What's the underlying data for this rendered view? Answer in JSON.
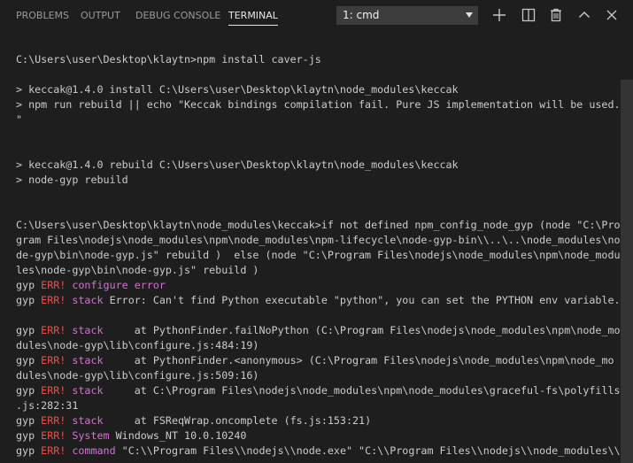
{
  "panel": {
    "tabs": [
      {
        "label": "PROBLEMS"
      },
      {
        "label": "OUTPUT"
      },
      {
        "label": "DEBUG CONSOLE"
      },
      {
        "label": "TERMINAL"
      }
    ],
    "active_tab": "TERMINAL",
    "terminal_select": {
      "value": "1: cmd"
    },
    "actions": [
      "plus-icon",
      "split-terminal-icon",
      "trash-icon",
      "chevron-up-icon",
      "close-icon"
    ]
  },
  "colors": {
    "background": "#1e1e1e",
    "text": "#cccccc",
    "error_red": "#f14c4c",
    "magenta": "#d670d6"
  },
  "terminal": {
    "lines": [
      [
        {
          "t": "C:\\Users\\user\\Desktop\\klaytn>npm install caver-js"
        }
      ],
      [
        {
          "t": ""
        }
      ],
      [
        {
          "t": "> keccak@1.4.0 install C:\\Users\\user\\Desktop\\klaytn\\node_modules\\keccak"
        }
      ],
      [
        {
          "t": "> npm run rebuild || echo \"Keccak bindings compilation fail. Pure JS implementation will be used."
        }
      ],
      [
        {
          "t": "\""
        }
      ],
      [
        {
          "t": ""
        }
      ],
      [
        {
          "t": ""
        }
      ],
      [
        {
          "t": "> keccak@1.4.0 rebuild C:\\Users\\user\\Desktop\\klaytn\\node_modules\\keccak"
        }
      ],
      [
        {
          "t": "> node-gyp rebuild"
        }
      ],
      [
        {
          "t": ""
        }
      ],
      [
        {
          "t": ""
        }
      ],
      [
        {
          "t": "C:\\Users\\user\\Desktop\\klaytn\\node_modules\\keccak>if not defined npm_config_node_gyp (node \"C:\\Pro"
        }
      ],
      [
        {
          "t": "gram Files\\nodejs\\node_modules\\npm\\node_modules\\npm-lifecycle\\node-gyp-bin\\\\..\\..\\node_modules\\no"
        }
      ],
      [
        {
          "t": "de-gyp\\bin\\node-gyp.js\" rebuild )  else (node \"C:\\Program Files\\nodejs\\node_modules\\npm\\node_modu"
        }
      ],
      [
        {
          "t": "les\\node-gyp\\bin\\node-gyp.js\" rebuild )"
        }
      ],
      [
        {
          "t": "gyp "
        },
        {
          "t": "ERR!",
          "c": "red"
        },
        {
          "t": " "
        },
        {
          "t": "configure error",
          "c": "mag"
        }
      ],
      [
        {
          "t": "gyp "
        },
        {
          "t": "ERR!",
          "c": "red"
        },
        {
          "t": " "
        },
        {
          "t": "stack",
          "c": "mag"
        },
        {
          "t": " Error: Can't find Python executable \"python\", you can set the PYTHON env variable."
        }
      ],
      [
        {
          "t": ""
        }
      ],
      [
        {
          "t": "gyp "
        },
        {
          "t": "ERR!",
          "c": "red"
        },
        {
          "t": " "
        },
        {
          "t": "stack",
          "c": "mag"
        },
        {
          "t": "     at PythonFinder.failNoPython (C:\\Program Files\\nodejs\\node_modules\\npm\\node_mo"
        }
      ],
      [
        {
          "t": "dules\\node-gyp\\lib\\configure.js:484:19)"
        }
      ],
      [
        {
          "t": "gyp "
        },
        {
          "t": "ERR!",
          "c": "red"
        },
        {
          "t": " "
        },
        {
          "t": "stack",
          "c": "mag"
        },
        {
          "t": "     at PythonFinder.<anonymous> (C:\\Program Files\\nodejs\\node_modules\\npm\\node_mo"
        }
      ],
      [
        {
          "t": "dules\\node-gyp\\lib\\configure.js:509:16)"
        }
      ],
      [
        {
          "t": "gyp "
        },
        {
          "t": "ERR!",
          "c": "red"
        },
        {
          "t": " "
        },
        {
          "t": "stack",
          "c": "mag"
        },
        {
          "t": "     at C:\\Program Files\\nodejs\\node_modules\\npm\\node_modules\\graceful-fs\\polyfills"
        }
      ],
      [
        {
          "t": ".js:282:31"
        }
      ],
      [
        {
          "t": "gyp "
        },
        {
          "t": "ERR!",
          "c": "red"
        },
        {
          "t": " "
        },
        {
          "t": "stack",
          "c": "mag"
        },
        {
          "t": "     at FSReqWrap.oncomplete (fs.js:153:21)"
        }
      ],
      [
        {
          "t": "gyp "
        },
        {
          "t": "ERR!",
          "c": "red"
        },
        {
          "t": " "
        },
        {
          "t": "System",
          "c": "mag"
        },
        {
          "t": " Windows_NT 10.0.10240"
        }
      ],
      [
        {
          "t": "gyp "
        },
        {
          "t": "ERR!",
          "c": "red"
        },
        {
          "t": " "
        },
        {
          "t": "command",
          "c": "mag"
        },
        {
          "t": " \"C:\\\\Program Files\\\\nodejs\\\\node.exe\" \"C:\\\\Program Files\\\\nodejs\\\\node_modules\\\\"
        }
      ]
    ]
  }
}
